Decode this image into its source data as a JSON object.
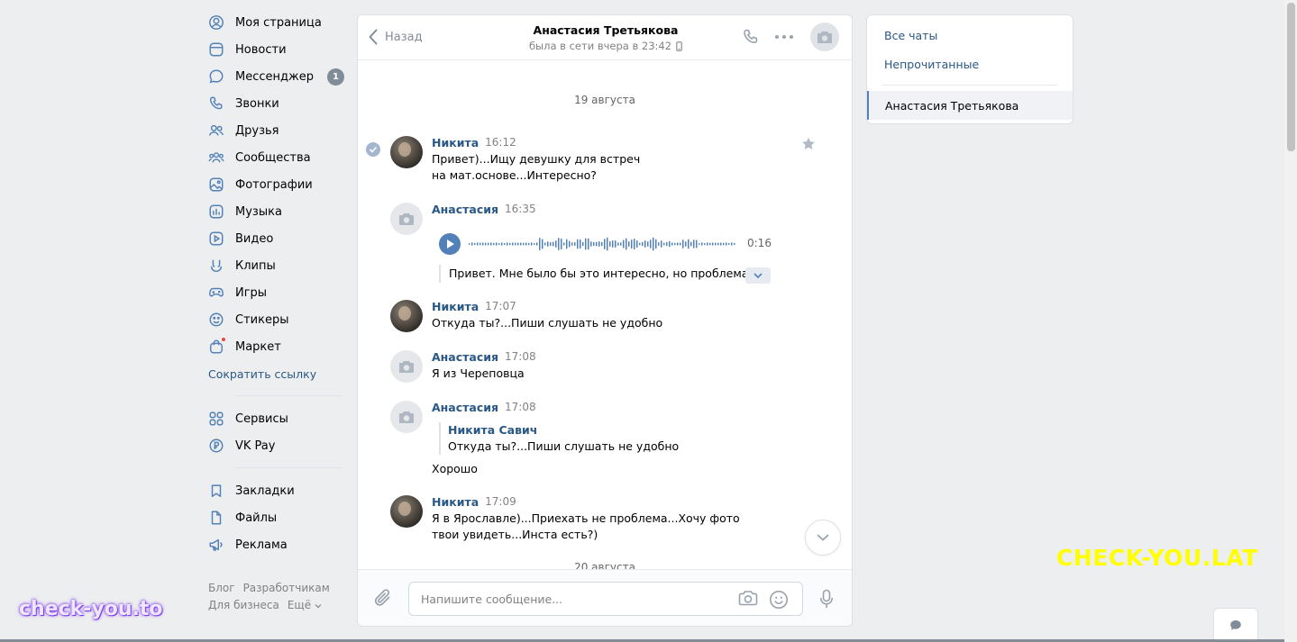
{
  "nav": {
    "items": [
      {
        "label": "Моя страница",
        "icon": "user-circle-icon"
      },
      {
        "label": "Новости",
        "icon": "news-icon"
      },
      {
        "label": "Мессенджер",
        "icon": "message-icon",
        "badge": "1"
      },
      {
        "label": "Звонки",
        "icon": "phone-icon"
      },
      {
        "label": "Друзья",
        "icon": "friends-icon"
      },
      {
        "label": "Сообщества",
        "icon": "communities-icon"
      },
      {
        "label": "Фотографии",
        "icon": "photos-icon"
      },
      {
        "label": "Музыка",
        "icon": "music-icon"
      },
      {
        "label": "Видео",
        "icon": "video-icon"
      },
      {
        "label": "Клипы",
        "icon": "clips-icon"
      },
      {
        "label": "Игры",
        "icon": "gamepad-icon"
      },
      {
        "label": "Стикеры",
        "icon": "smile-icon"
      },
      {
        "label": "Маркет",
        "icon": "market-icon"
      }
    ],
    "shorten_link": "Сократить ссылку",
    "services": [
      {
        "label": "Сервисы",
        "icon": "grid-icon"
      },
      {
        "label": "VK Pay",
        "icon": "vkpay-icon"
      }
    ],
    "extras": [
      {
        "label": "Закладки",
        "icon": "bookmark-icon"
      },
      {
        "label": "Файлы",
        "icon": "file-icon"
      },
      {
        "label": "Реклама",
        "icon": "megaphone-icon"
      }
    ],
    "footer": {
      "blog": "Блог",
      "developers": "Разработчикам",
      "business": "Для бизнеса",
      "more": "Ещё"
    }
  },
  "chat": {
    "back_label": "Назад",
    "peer_name": "Анастасия Третьякова",
    "peer_status": "была в сети вчера в 23:42",
    "dates": [
      "19 августа",
      "20 августа"
    ],
    "messages": [
      {
        "author": "Никита",
        "time": "16:12",
        "text": "Привет)...Ищу девушку для встреч на мат.основе...Интересно?"
      },
      {
        "author": "Анастасия",
        "time": "16:35",
        "voice_duration": "0:16",
        "transcript": "Привет. Мне было бы это интересно, но проблема в"
      },
      {
        "author": "Никита",
        "time": "17:07",
        "text": "Откуда ты?...Пиши слушать не удобно"
      },
      {
        "author": "Анастасия",
        "time": "17:08",
        "text": "Я из Череповца"
      },
      {
        "author": "Анастасия",
        "time": "17:08",
        "quote_author": "Никита Савич",
        "quote_text": "Откуда ты?...Пиши слушать не удобно",
        "text": "Хорошо"
      },
      {
        "author": "Никита",
        "time": "17:09",
        "text": "Я в Ярославле)...Приехать не проблема...Хочу фото твои увидеть...Инста есть?)"
      }
    ],
    "input_placeholder": "Напишите сообщение..."
  },
  "right_panel": {
    "all_chats": "Все чаты",
    "unread": "Непрочитанные",
    "active_chat": "Анастасия Третьякова"
  },
  "watermarks": {
    "left": "check-you.to",
    "right": "CHECK-YOU.LAT"
  },
  "colors": {
    "link": "#2a5885",
    "accent": "#5181b8",
    "background": "#edeef0",
    "badge": "#818c99",
    "watermark_right": "#ffff00"
  }
}
